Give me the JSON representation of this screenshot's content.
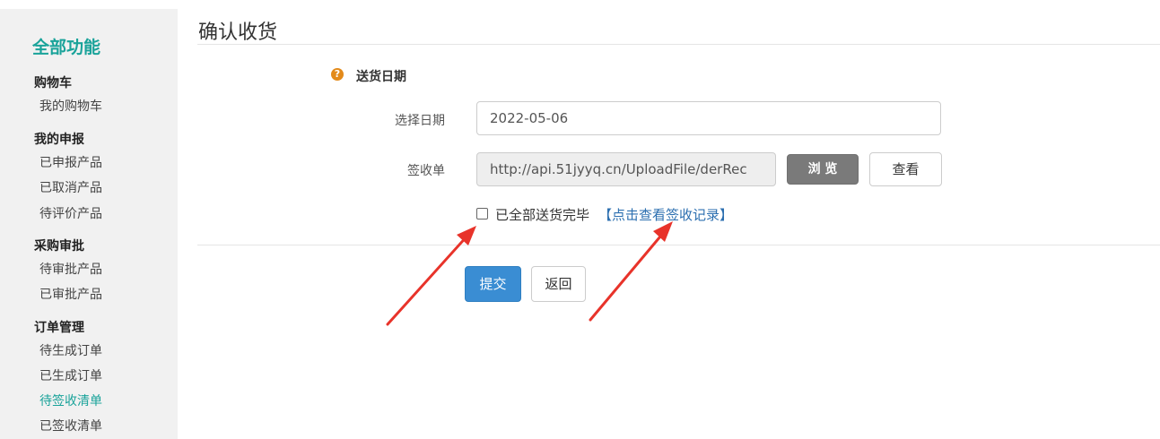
{
  "sidebar": {
    "heading": "全部功能",
    "sections": [
      {
        "title": "购物车",
        "items": [
          "我的购物车"
        ]
      },
      {
        "title": "我的申报",
        "items": [
          "已申报产品",
          "已取消产品",
          "待评价产品"
        ]
      },
      {
        "title": "采购审批",
        "items": [
          "待审批产品",
          "已审批产品"
        ]
      },
      {
        "title": "订单管理",
        "items": [
          "待生成订单",
          "已生成订单",
          "待签收清单",
          "已签收清单"
        ]
      }
    ],
    "active_item": "待签收清单",
    "accent_color": "#1aa39a"
  },
  "page": {
    "title": "确认收货"
  },
  "form": {
    "section_icon": "question-circle-icon",
    "section_title": "送货日期",
    "date_label": "选择日期",
    "date_value": "2022-05-06",
    "receipt_label": "签收单",
    "receipt_value": "http://api.51jyyq.cn/UploadFile/derRec",
    "browse_button": "浏 览",
    "view_button": "查看",
    "checkbox_label": "已全部送货完毕",
    "checkbox_checked": false,
    "link_text": "【点击查看签收记录】",
    "submit_button": "提交",
    "back_button": "返回"
  },
  "annotations": {
    "arrow_color": "#e8332a",
    "arrow_count": 2
  }
}
